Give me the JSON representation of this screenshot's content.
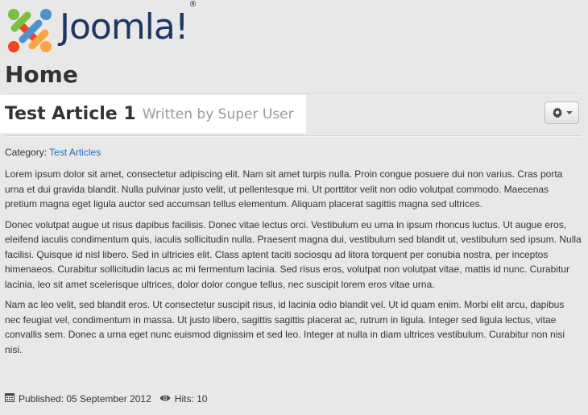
{
  "site": {
    "logo_text": "Joomla!",
    "registered_mark": "®",
    "brand_colors": [
      "#1c3764",
      "#f44321",
      "#5091cd",
      "#f9a541",
      "#7ac143"
    ]
  },
  "page": {
    "heading": "Home"
  },
  "article": {
    "title": "Test Article 1",
    "byline": "Written by Super User",
    "category_label": "Category:",
    "category_link": "Test Articles",
    "paragraphs": [
      "Lorem ipsum dolor sit amet, consectetur adipiscing elit. Nam sit amet turpis nulla. Proin congue posuere dui non varius. Cras porta urna et dui gravida blandit. Nulla pulvinar justo velit, ut pellentesque mi. Ut porttitor velit non odio volutpat commodo. Maecenas pretium magna eget ligula auctor sed accumsan tellus elementum. Aliquam placerat sagittis magna sed ultrices.",
      "Donec volutpat augue ut risus dapibus facilisis. Donec vitae lectus orci. Vestibulum eu urna in ipsum rhoncus luctus. Ut augue eros, eleifend iaculis condimentum quis, iaculis sollicitudin nulla. Praesent magna dui, vestibulum sed blandit ut, vestibulum sed ipsum. Nulla facilisi. Quisque id nisl libero. Sed in ultricies elit. Class aptent taciti sociosqu ad litora torquent per conubia nostra, per inceptos himenaeos. Curabitur sollicitudin lacus ac mi fermentum lacinia. Sed risus eros, volutpat non volutpat vitae, mattis id nunc. Curabitur lacinia, leo sit amet scelerisque ultrices, dolor dolor congue tellus, nec suscipit lorem eros vitae urna.",
      "Nam ac leo velit, sed blandit eros. Ut consectetur suscipit risus, id lacinia odio blandit vel. Ut id quam enim. Morbi elit arcu, dapibus nec feugiat vel, condimentum in massa. Ut justo libero, sagittis sagittis placerat ac, rutrum in ligula. Integer sed ligula lectus, vitae convallis sem. Donec a urna eget nunc euismod dignissim et sed leo. Integer at nulla in diam ultrices vestibulum. Curabitur non nisi nisi."
    ],
    "published": "Published: 05 September 2012",
    "hits": "Hits: 10"
  },
  "icons": {
    "tools": "gear-icon",
    "published": "calendar-icon",
    "hits": "eye-icon"
  }
}
